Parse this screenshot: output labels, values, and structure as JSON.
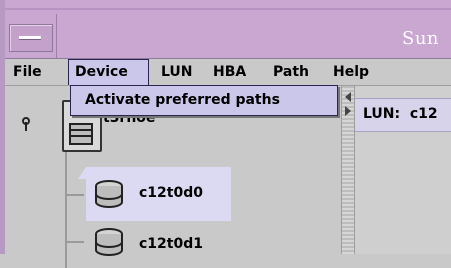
{
  "window": {
    "title": "Sun"
  },
  "menubar": {
    "items": [
      {
        "label": "File"
      },
      {
        "label": "Device"
      },
      {
        "label": "LUN"
      },
      {
        "label": "HBA"
      },
      {
        "label": "Path"
      },
      {
        "label": "Help"
      }
    ]
  },
  "device_menu": {
    "items": [
      {
        "label": "Activate preferred paths"
      }
    ]
  },
  "tree": {
    "root": {
      "label": "t3rnoe",
      "icon": "storage-array-icon"
    },
    "children": [
      {
        "label": "c12t0d0",
        "icon": "disk-icon",
        "selected": true
      },
      {
        "label": "c12t0d1",
        "icon": "disk-icon",
        "selected": false
      }
    ]
  },
  "detail": {
    "lun_label": "LUN:",
    "lun_value": "c12"
  },
  "colors": {
    "titlebar": "#c9a7d0",
    "menu_highlight": "#cbc7ea",
    "selection": "#dcdaf2"
  }
}
